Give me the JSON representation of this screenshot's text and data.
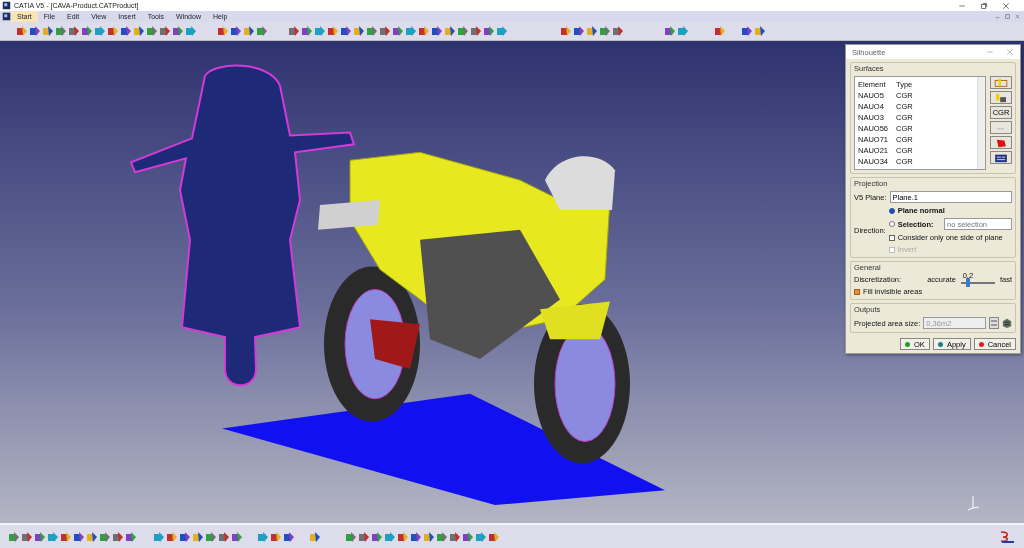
{
  "window": {
    "title": "CATIA V5 - [CAVA-Product.CATProduct]"
  },
  "menu": [
    {
      "label": "Start",
      "selected": true
    },
    {
      "label": "File",
      "selected": false
    },
    {
      "label": "Edit",
      "selected": false
    },
    {
      "label": "View",
      "selected": false
    },
    {
      "label": "Insert",
      "selected": false
    },
    {
      "label": "Tools",
      "selected": false
    },
    {
      "label": "Window",
      "selected": false
    },
    {
      "label": "Help",
      "selected": false
    }
  ],
  "dialog": {
    "title": "Silhouette",
    "surfaces": {
      "title": "Surfaces",
      "columns": [
        "Element",
        "Type"
      ],
      "rows": [
        [
          "NAUO5",
          "CGR"
        ],
        [
          "NAUO4",
          "CGR"
        ],
        [
          "NAUO3",
          "CGR"
        ],
        [
          "NAUO56",
          "CGR"
        ],
        [
          "NAUO71",
          "CGR"
        ],
        [
          "NAUO21",
          "CGR"
        ],
        [
          "NAUO34",
          "CGR"
        ]
      ],
      "side_buttons": [
        {
          "kind": "select"
        },
        {
          "kind": "assembly"
        },
        {
          "kind": "text",
          "label": "CGR"
        },
        {
          "kind": "dots"
        },
        {
          "kind": "shape"
        },
        {
          "kind": "list"
        }
      ]
    },
    "projection": {
      "title": "Projection",
      "plane_label": "V5 Plane:",
      "plane_value": "Plane.1",
      "direction_label": "Direction:",
      "options": [
        {
          "label": "Plane normal",
          "selected": true
        },
        {
          "label": "Selection:",
          "selected": false
        }
      ],
      "selection_placeholder": "no selection",
      "checks": [
        {
          "label": "Consider only one side of plane",
          "checked": false,
          "disabled": false
        },
        {
          "label": "Invert",
          "checked": false,
          "disabled": true
        }
      ]
    },
    "general": {
      "title": "General",
      "label": "Discretization:",
      "min_label": "accurate",
      "max_label": "fast",
      "value": "0.2",
      "level": 0.2,
      "fill": {
        "label": "Fill invisible areas",
        "checked": true
      }
    },
    "outputs": {
      "title": "Outputs",
      "label": "Projected area size:",
      "value": "0,36m2"
    },
    "buttons": [
      {
        "label": "OK",
        "kind": "ok"
      },
      {
        "label": "Apply",
        "kind": "apply"
      },
      {
        "label": "Cancel",
        "kind": "cancel"
      }
    ]
  }
}
